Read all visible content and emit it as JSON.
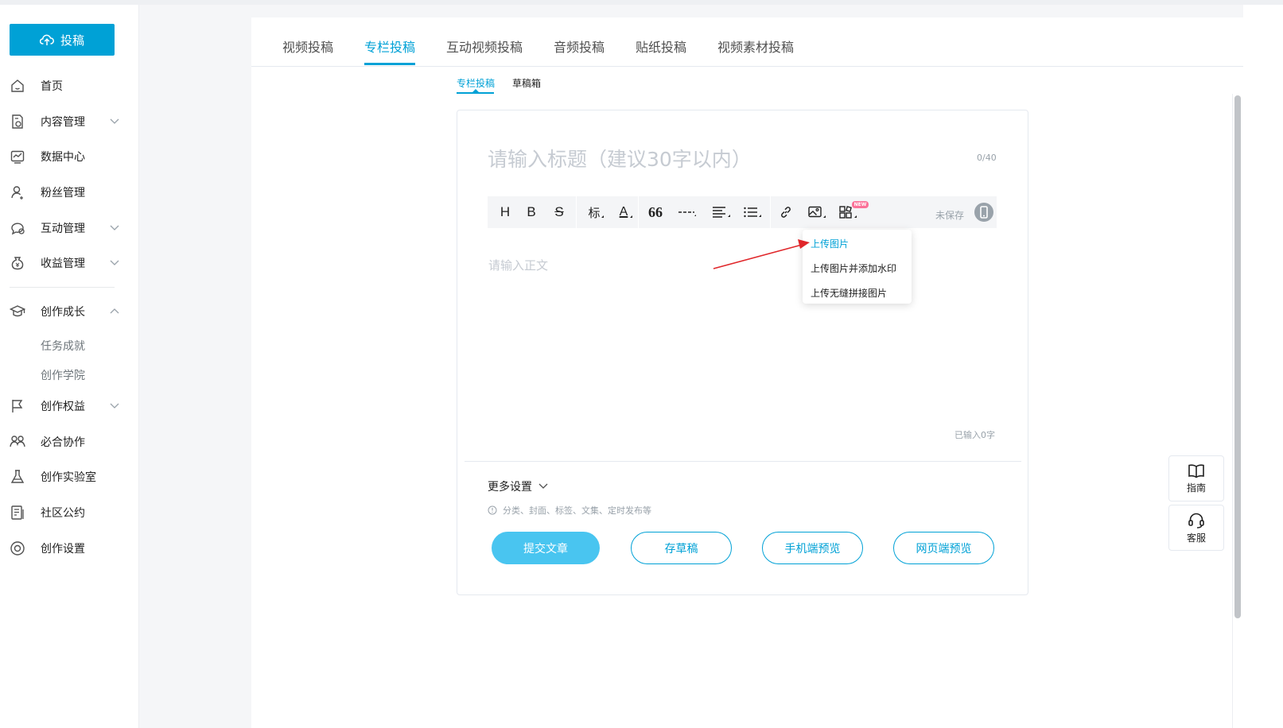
{
  "colors": {
    "accent": "#00a1d6",
    "submit_bg": "#49c5f0",
    "badge": "#fb7299",
    "arrow": "#e0262a"
  },
  "sidebar": {
    "upload_label": "投稿",
    "items": [
      {
        "label": "首页",
        "icon": "home-icon"
      },
      {
        "label": "内容管理",
        "icon": "content-icon",
        "expandable": true
      },
      {
        "label": "数据中心",
        "icon": "chart-icon"
      },
      {
        "label": "粉丝管理",
        "icon": "user-icon"
      },
      {
        "label": "互动管理",
        "icon": "comment-icon",
        "expandable": true
      },
      {
        "label": "收益管理",
        "icon": "money-bag-icon",
        "expandable": true
      },
      {
        "label": "创作成长",
        "icon": "graduation-cap-icon",
        "expanded": true
      },
      {
        "label": "创作权益",
        "icon": "flag-icon",
        "expandable": true
      },
      {
        "label": "必合协作",
        "icon": "people-icon"
      },
      {
        "label": "创作实验室",
        "icon": "flask-icon"
      },
      {
        "label": "社区公约",
        "icon": "document-icon"
      },
      {
        "label": "创作设置",
        "icon": "settings-icon"
      }
    ],
    "subitems": [
      "任务成就",
      "创作学院"
    ]
  },
  "tabs": [
    {
      "label": "视频投稿"
    },
    {
      "label": "专栏投稿",
      "active": true
    },
    {
      "label": "互动视频投稿"
    },
    {
      "label": "音频投稿"
    },
    {
      "label": "贴纸投稿"
    },
    {
      "label": "视频素材投稿"
    }
  ],
  "subtabs": [
    {
      "label": "专栏投稿",
      "active": true
    },
    {
      "label": "草稿箱"
    }
  ],
  "editor": {
    "title_placeholder": "请输入标题（建议30字以内）",
    "title_count": "0/40",
    "toolbar": {
      "heading": "H",
      "bold": "B",
      "strike": "S",
      "label": "标",
      "font_color": "A",
      "quote": "66",
      "new_badge": "NEW",
      "save_status": "未保存"
    },
    "body_placeholder": "请输入正文",
    "word_count": "已输入0字"
  },
  "image_dropdown": [
    "上传图片",
    "上传图片并添加水印",
    "上传无缝拼接图片"
  ],
  "more_settings": {
    "label": "更多设置",
    "hint": "分类、封面、标签、文集、定时发布等"
  },
  "actions": {
    "submit": "提交文章",
    "draft": "存草稿",
    "mobile_preview": "手机端预览",
    "web_preview": "网页端预览"
  },
  "float_help": {
    "guide": "指南",
    "service": "客服"
  }
}
